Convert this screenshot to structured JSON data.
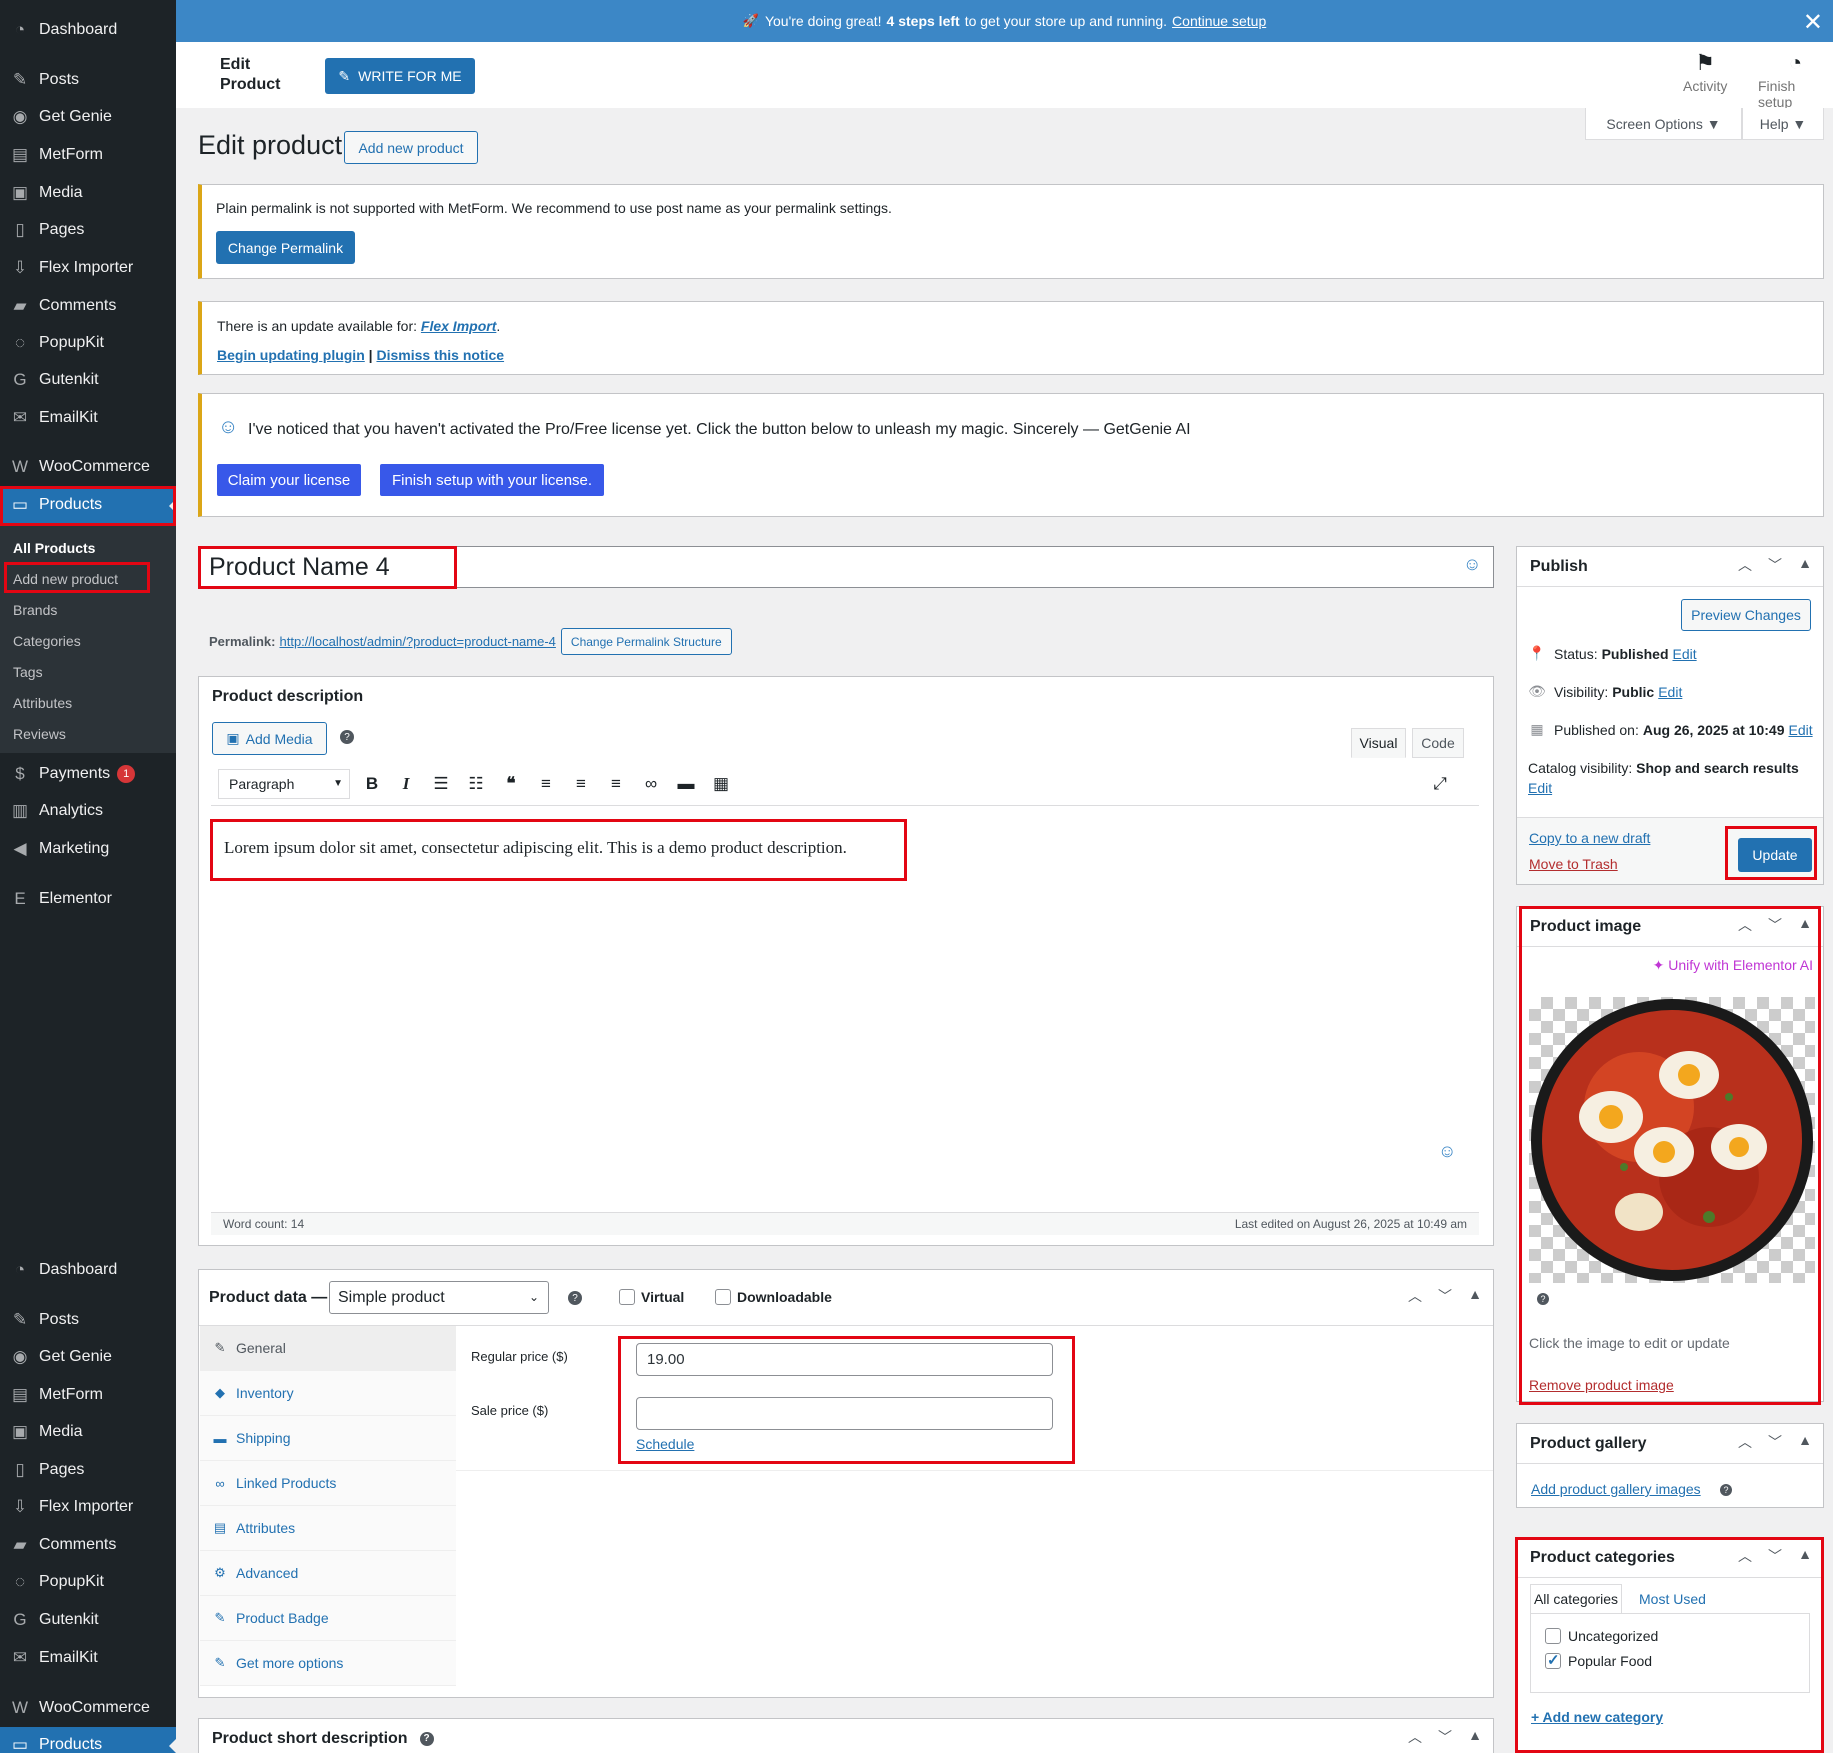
{
  "notification": {
    "emoji": "🚀",
    "text_pre": "You're doing great!",
    "text_bold": "4 steps left",
    "text_post": "to get your store up and running.",
    "link": "Continue setup"
  },
  "sidebar": {
    "items": [
      {
        "label": "Dashboard",
        "icon": "dashboard-icon",
        "glyph": "◔"
      },
      {
        "label": "Posts",
        "icon": "pin-icon",
        "glyph": "✎"
      },
      {
        "label": "Get Genie",
        "icon": "genie-icon",
        "glyph": "◉"
      },
      {
        "label": "MetForm",
        "icon": "form-icon",
        "glyph": "▤"
      },
      {
        "label": "Media",
        "icon": "media-icon",
        "glyph": "▣"
      },
      {
        "label": "Pages",
        "icon": "pages-icon",
        "glyph": "▯"
      },
      {
        "label": "Flex Importer",
        "icon": "importer-icon",
        "glyph": "⇩"
      },
      {
        "label": "Comments",
        "icon": "comment-icon",
        "glyph": "▰"
      },
      {
        "label": "PopupKit",
        "icon": "popup-icon",
        "glyph": "◌"
      },
      {
        "label": "Gutenkit",
        "icon": "gutenkit-icon",
        "glyph": "G"
      },
      {
        "label": "EmailKit",
        "icon": "email-icon",
        "glyph": "✉"
      },
      {
        "label": "WooCommerce",
        "icon": "woo-icon",
        "glyph": "W"
      },
      {
        "label": "Products",
        "icon": "archive-icon",
        "glyph": "▭"
      }
    ],
    "submenu": [
      "All Products",
      "Add new product",
      "Brands",
      "Categories",
      "Tags",
      "Attributes",
      "Reviews"
    ],
    "after": [
      {
        "label": "Payments",
        "icon": "payments-icon",
        "glyph": "$",
        "badge": "1"
      },
      {
        "label": "Analytics",
        "icon": "analytics-icon",
        "glyph": "▥"
      },
      {
        "label": "Marketing",
        "icon": "megaphone-icon",
        "glyph": "◀"
      },
      {
        "label": "Elementor",
        "icon": "elementor-icon",
        "glyph": "E"
      }
    ],
    "repeat": [
      {
        "label": "Dashboard",
        "icon": "dashboard-icon",
        "glyph": "◔"
      },
      {
        "label": "Posts",
        "icon": "pin-icon",
        "glyph": "✎"
      },
      {
        "label": "Get Genie",
        "icon": "genie-icon",
        "glyph": "◉"
      },
      {
        "label": "MetForm",
        "icon": "form-icon",
        "glyph": "▤"
      },
      {
        "label": "Media",
        "icon": "media-icon",
        "glyph": "▣"
      },
      {
        "label": "Pages",
        "icon": "pages-icon",
        "glyph": "▯"
      },
      {
        "label": "Flex Importer",
        "icon": "importer-icon",
        "glyph": "⇩"
      },
      {
        "label": "Comments",
        "icon": "comment-icon",
        "glyph": "▰"
      },
      {
        "label": "PopupKit",
        "icon": "popup-icon",
        "glyph": "◌"
      },
      {
        "label": "Gutenkit",
        "icon": "gutenkit-icon",
        "glyph": "G"
      },
      {
        "label": "EmailKit",
        "icon": "email-icon",
        "glyph": "✉"
      },
      {
        "label": "WooCommerce",
        "icon": "woo-icon",
        "glyph": "W"
      },
      {
        "label": "Products",
        "icon": "archive-icon",
        "glyph": "▭"
      }
    ]
  },
  "header": {
    "title": "Edit Product",
    "write_btn": "WRITE FOR ME",
    "activity": "Activity",
    "finish_setup": "Finish setup",
    "screen_options": "Screen Options ▼",
    "help": "Help ▼"
  },
  "page": {
    "title": "Edit product",
    "add_new": "Add new product"
  },
  "notices": {
    "permalink_text": "Plain permalink is not supported with MetForm. We recommend to use post name as your permalink settings.",
    "change_permalink": "Change Permalink",
    "update_pre": "There is an update available for:",
    "update_plugin": "Flex Import",
    "begin_update": "Begin updating plugin",
    "separator": "|",
    "dismiss": "Dismiss this notice",
    "genie_text": "I've noticed that you haven't activated the Pro/Free license yet. Click the button below to unleash my magic. Sincerely — GetGenie AI",
    "claim": "Claim your license",
    "finish": "Finish setup with your license."
  },
  "product": {
    "name": "Product Name 4",
    "permalink_label": "Permalink:",
    "permalink_url": "http://localhost/admin/?product=product-name-4",
    "change_structure": "Change Permalink Structure"
  },
  "description": {
    "title": "Product description",
    "add_media": "Add Media",
    "tab_visual": "Visual",
    "tab_code": "Code",
    "paragraph": "Paragraph",
    "content": "Lorem ipsum dolor sit amet, consectetur adipiscing elit. This is a demo product description.",
    "word_count": "Word count: 14",
    "last_edited": "Last edited on August 26, 2025 at 10:49 am"
  },
  "product_data": {
    "title": "Product data —",
    "type": "Simple product",
    "virtual": "Virtual",
    "downloadable": "Downloadable",
    "tabs": [
      {
        "label": "General",
        "icon": "wrench-icon",
        "glyph": "✎"
      },
      {
        "label": "Inventory",
        "icon": "tag-icon",
        "glyph": "◆"
      },
      {
        "label": "Shipping",
        "icon": "truck-icon",
        "glyph": "▬"
      },
      {
        "label": "Linked Products",
        "icon": "link-icon",
        "glyph": "∞"
      },
      {
        "label": "Attributes",
        "icon": "list-icon",
        "glyph": "▤"
      },
      {
        "label": "Advanced",
        "icon": "gear-icon",
        "glyph": "⚙"
      },
      {
        "label": "Product Badge",
        "icon": "wrench-icon",
        "glyph": "✎"
      },
      {
        "label": "Get more options",
        "icon": "plugin-icon",
        "glyph": "✎"
      }
    ],
    "regular_price_label": "Regular price ($)",
    "regular_price": "19.00",
    "sale_price_label": "Sale price ($)",
    "sale_price": "",
    "schedule": "Schedule"
  },
  "short_description": {
    "title": "Product short description"
  },
  "publish": {
    "title": "Publish",
    "preview": "Preview Changes",
    "status_label": "Status:",
    "status": "Published",
    "visibility_label": "Visibility:",
    "visibility": "Public",
    "published_label": "Published on:",
    "published": "Aug 26, 2025 at 10:49",
    "catalog_label": "Catalog visibility:",
    "catalog": "Shop and search results",
    "edit": "Edit",
    "copy_draft": "Copy to a new draft",
    "trash": "Move to Trash",
    "update": "Update"
  },
  "product_image": {
    "title": "Product image",
    "unify": "Unify with Elementor AI",
    "hint": "Click the image to edit or update",
    "remove": "Remove product image"
  },
  "gallery": {
    "title": "Product gallery",
    "add": "Add product gallery images"
  },
  "categories": {
    "title": "Product categories",
    "tab_all": "All categories",
    "tab_used": "Most Used",
    "items": [
      {
        "label": "Uncategorized",
        "checked": false
      },
      {
        "label": "Popular Food",
        "checked": true
      }
    ],
    "add": "+ Add new category"
  },
  "colors": {
    "accent": "#2271b1",
    "sidebar": "#1d2327",
    "highlight": "#e30613",
    "indigo": "#3858e9"
  }
}
